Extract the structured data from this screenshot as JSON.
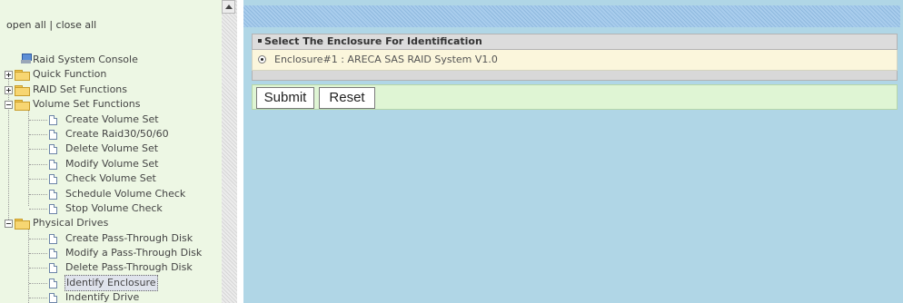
{
  "nav": {
    "open_all": "open all",
    "separator": "|",
    "close_all": "close all"
  },
  "tree": {
    "root": "Raid System Console",
    "quick_function": "Quick Function",
    "raid_set_functions": "RAID Set Functions",
    "volume_set_functions": "Volume Set Functions",
    "volume_items": [
      "Create Volume Set",
      "Create Raid30/50/60",
      "Delete Volume Set",
      "Modify Volume Set",
      "Check Volume Set",
      "Schedule Volume Check",
      "Stop Volume Check"
    ],
    "physical_drives": "Physical Drives",
    "physical_items": [
      "Create Pass-Through Disk",
      "Modify a Pass-Through Disk",
      "Delete Pass-Through Disk",
      "Identify Enclosure",
      "Indentify Drive"
    ],
    "selected_item": "Identify Enclosure"
  },
  "panel": {
    "title": "Select The Enclosure For Identification",
    "enclosure_option": "Enclosure#1 : ARECA SAS RAID System V1.0",
    "enclosure_selected": true
  },
  "buttons": {
    "submit": "Submit",
    "reset": "Reset"
  }
}
